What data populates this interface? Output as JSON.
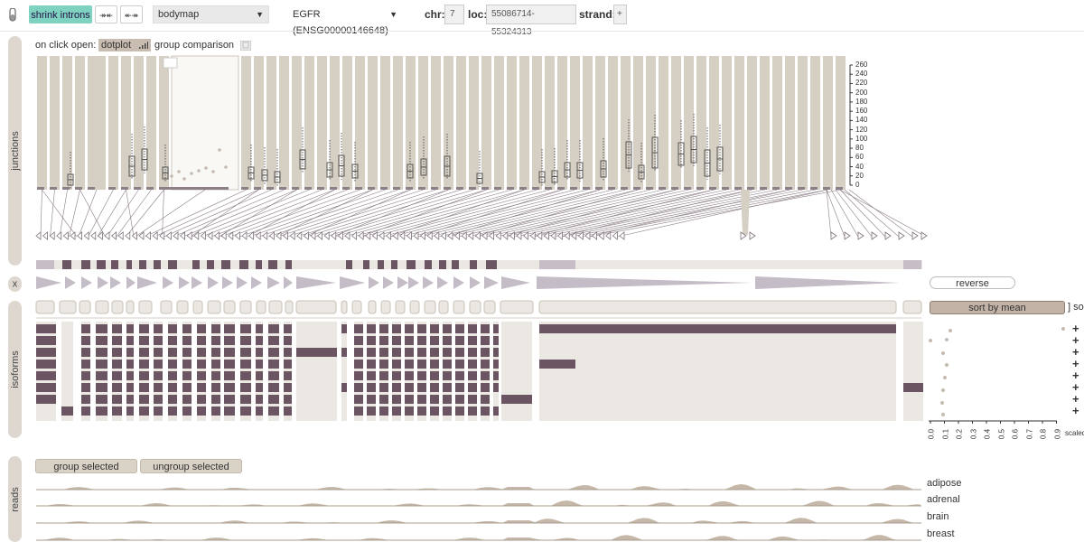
{
  "toolbar": {
    "shrink_introns_label": "shrink introns",
    "narrow_icon": "↠↞",
    "widen_icon": "↞↠",
    "dataset_select": "bodymap",
    "gene_select": "EGFR (ENSG00000146648)",
    "chr_label": "chr:",
    "chr_value": "7",
    "loc_label": "loc:",
    "loc_value": "55086714-55324313",
    "strand_label": "strand:",
    "strand_value": "+",
    "accent": "#7fd1c0"
  },
  "junctions": {
    "tab_label": "junctions",
    "on_click_open": "on click open:",
    "dotplot_label": "dotplot",
    "group_comparison_label": "group comparison",
    "axis_ticks": [
      "260",
      "240",
      "220",
      "200",
      "180",
      "160",
      "140",
      "120",
      "100",
      "80",
      "60",
      "40",
      "20",
      "0"
    ]
  },
  "exons": {
    "x_button": "x",
    "reverse_label": "reverse",
    "sort_by_mean_label": "sort by mean",
    "sort_trailing": "] so"
  },
  "isoforms": {
    "tab_label": "isoforms",
    "scale_ticks": [
      "0.0",
      "0.1",
      "0.2",
      "0.3",
      "0.4",
      "0.5",
      "0.6",
      "0.7",
      "0.8",
      "0.9"
    ],
    "scale_label": "scaled",
    "plus_marks": [
      "+",
      "+",
      "+",
      "+",
      "+",
      "+",
      "+",
      "+"
    ]
  },
  "reads": {
    "tab_label": "reads",
    "group_selected_label": "group selected",
    "ungroup_selected_label": "ungroup selected",
    "tracks": [
      "adipose",
      "adrenal",
      "brain",
      "breast"
    ]
  },
  "colors": {
    "junction_bg": "#d6cfc4",
    "isoform_exon": "#6b5563",
    "light_bg": "#ebe7e2",
    "arrow": "#c4bcc6"
  }
}
